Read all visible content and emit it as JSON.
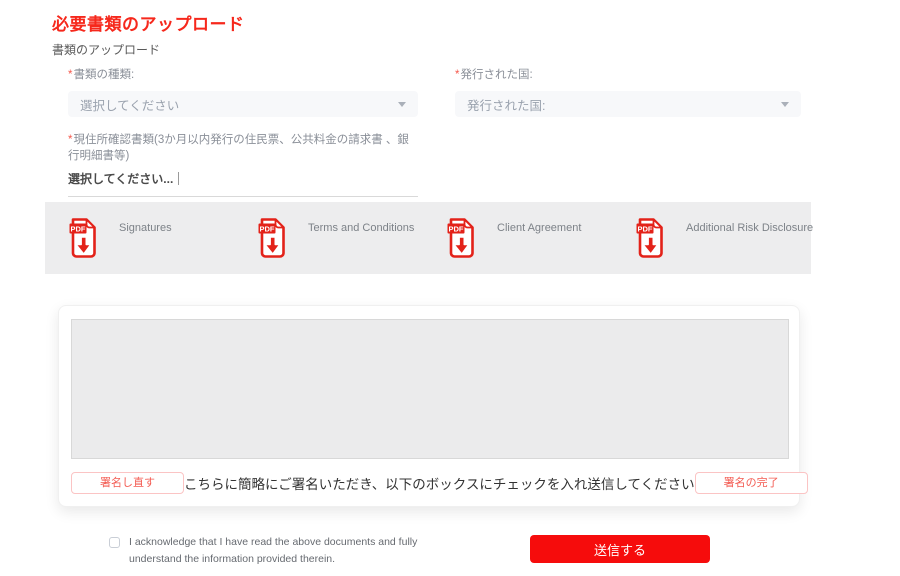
{
  "page": {
    "title": "必要書類のアップロード",
    "subtitle": "書類のアップロード"
  },
  "form": {
    "required_mark": "*",
    "doc_type": {
      "label": "書類の種類:",
      "value": "選択してください"
    },
    "country": {
      "label": "発行された国:",
      "value": "発行された国:"
    },
    "address_proof": {
      "label": "現住所確認書類(3か月以内発行の住民票、公共料金の請求書 、銀行明細書等)",
      "value": "選択してください..."
    }
  },
  "documents": {
    "pdf_badge": "PDF",
    "items": [
      {
        "icon": "pdf-file-icon",
        "label": "Signatures"
      },
      {
        "icon": "pdf-file-icon",
        "label": "Terms and Conditions"
      },
      {
        "icon": "pdf-file-icon",
        "label": "Client Agreement"
      },
      {
        "icon": "pdf-file-icon",
        "label": "Additional Risk Disclosure"
      }
    ]
  },
  "signature": {
    "clear_button": "署名し直す",
    "instruction": "こちらに簡略にご署名いただき、以下のボックスにチェックを入れ送信してください",
    "done_button": "署名の完了"
  },
  "footer": {
    "acknowledge_line1": "I acknowledge that I have read the above documents and fully",
    "acknowledge_line2": "understand the information provided therein.",
    "checkbox_checked": false,
    "submit_button": "送信する"
  },
  "colors": {
    "title_red": "#f6281c",
    "pdf_red": "#e32219",
    "outline_button_red": "#f35b52",
    "submit_red": "#f60c0c",
    "strip_gray": "#ededee"
  }
}
